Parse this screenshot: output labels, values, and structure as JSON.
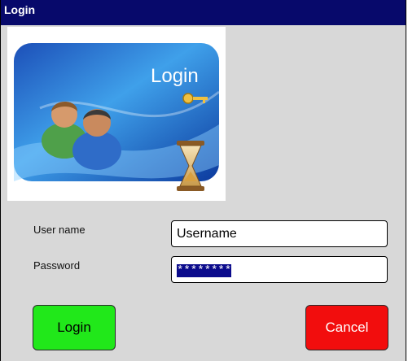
{
  "window": {
    "title": "Login"
  },
  "banner": {
    "caption": "Login"
  },
  "form": {
    "username_label": "User name",
    "username_value": "Username",
    "password_label": "Password",
    "password_value": "********"
  },
  "buttons": {
    "login_label": "Login",
    "cancel_label": "Cancel"
  },
  "colors": {
    "titlebar": "#07096b",
    "login_button": "#21e81a",
    "cancel_button": "#f20d0d",
    "window_bg": "#d8d8d8"
  },
  "icons": [
    "users-icon",
    "key-icon",
    "hourglass-icon"
  ]
}
